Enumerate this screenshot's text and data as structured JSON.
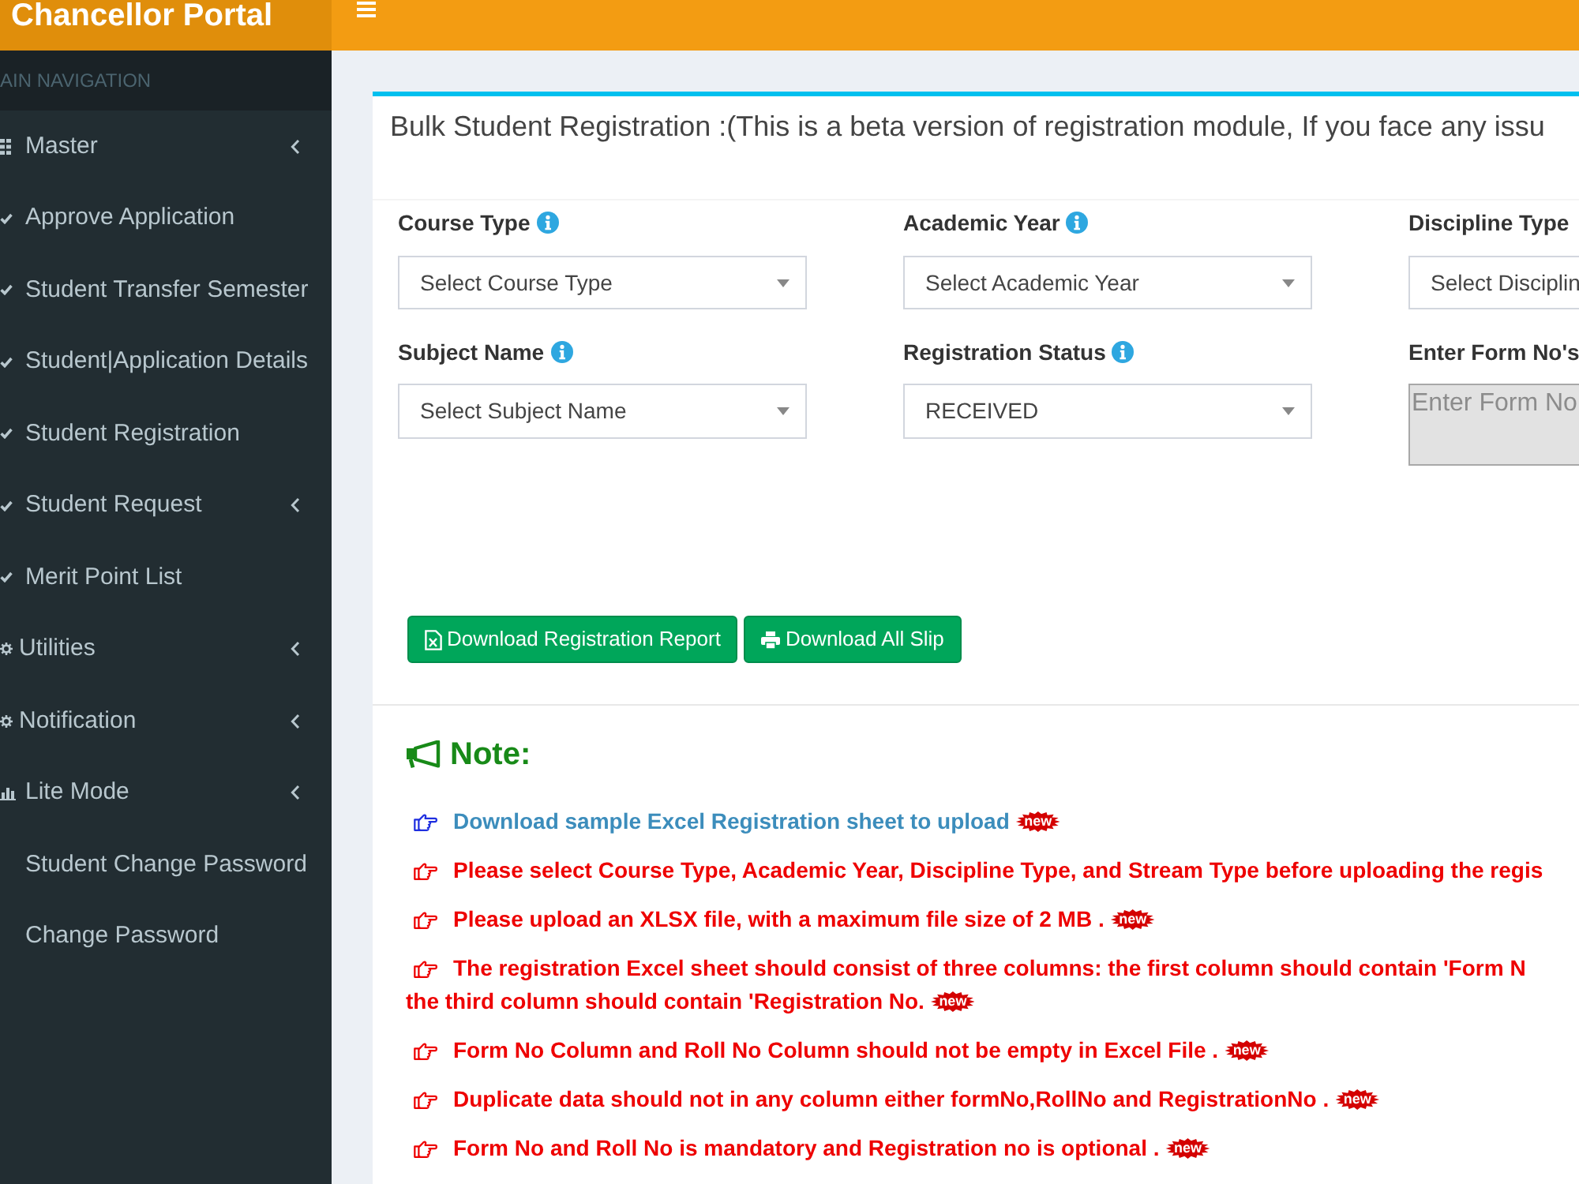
{
  "header": {
    "title": "Chancellor Portal"
  },
  "sidebar": {
    "section_title": "AIN NAVIGATION",
    "items": [
      {
        "label": "Master",
        "submenu": true
      },
      {
        "label": "Approve Application",
        "submenu": false
      },
      {
        "label": "Student Transfer Semester",
        "submenu": false
      },
      {
        "label": "Student|Application Details",
        "submenu": false
      },
      {
        "label": "Student Registration",
        "submenu": false
      },
      {
        "label": "Student Request",
        "submenu": true
      },
      {
        "label": "Merit Point List",
        "submenu": false
      },
      {
        "label": "Utilities",
        "submenu": true
      },
      {
        "label": "Notification",
        "submenu": true
      },
      {
        "label": "Lite Mode",
        "submenu": true
      },
      {
        "label": "Student Change Password",
        "submenu": false
      },
      {
        "label": "Change Password",
        "submenu": false
      }
    ]
  },
  "panel": {
    "title": "Bulk Student Registration :(This is a beta version of registration module, If you face any issu",
    "fields": [
      {
        "label": "Course Type",
        "info": true,
        "kind": "select",
        "value": "Select Course Type"
      },
      {
        "label": "Academic Year",
        "info": true,
        "kind": "select",
        "value": "Select Academic Year"
      },
      {
        "label": "Discipline Type",
        "info": false,
        "kind": "select",
        "value": "Select Disciplin"
      },
      {
        "label": "Subject Name",
        "info": true,
        "kind": "select",
        "value": "Select Subject Name"
      },
      {
        "label": "Registration Status",
        "info": true,
        "kind": "select",
        "value": "RECEIVED"
      },
      {
        "label": "Enter Form No's",
        "info": false,
        "kind": "textarea",
        "placeholder": "Enter Form No"
      }
    ],
    "buttons": [
      {
        "label": "Download Registration Report"
      },
      {
        "label": "Download All Slip"
      }
    ],
    "note": {
      "title": "Note:",
      "items": [
        {
          "kind": "link",
          "text": "Download sample Excel Registration sheet to upload",
          "badge": "new"
        },
        {
          "kind": "text",
          "text": "Please select Course Type, Academic Year, Discipline Type, and Stream Type before uploading the regis"
        },
        {
          "kind": "text",
          "text": "Please upload an XLSX file, with a maximum file size of 2 MB .",
          "badge": "new"
        },
        {
          "kind": "text",
          "text": "The registration Excel sheet should consist of three columns: the first column should contain 'Form N",
          "continuation": "the third column should contain 'Registration No.",
          "badge": "new"
        },
        {
          "kind": "text",
          "text": "Form No Column and Roll No Column should not be empty in Excel File .",
          "badge": "new"
        },
        {
          "kind": "text",
          "text": "Duplicate data should not in any column either formNo,RollNo and RegistrationNo .",
          "badge": "new"
        },
        {
          "kind": "text",
          "text": "Form No and Roll No is mandatory and Registration no is optional .",
          "badge": "new"
        }
      ]
    }
  }
}
